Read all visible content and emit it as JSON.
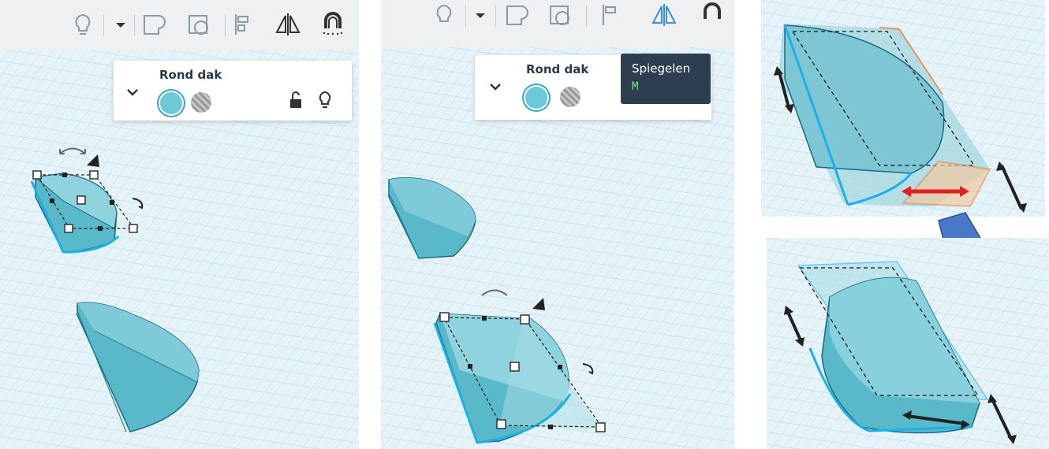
{
  "panel_left": {
    "properties": {
      "shape_name": "Rond dak",
      "solid_color": "#6cc9d8",
      "icons": [
        "chevron-down-icon",
        "unlock-icon",
        "lightbulb-icon"
      ]
    },
    "toolbar_icons": [
      "lightbulb-icon",
      "dropdown-caret-icon",
      "group-icon",
      "ungroup-icon",
      "align-icon",
      "mirror-icon",
      "magnet-icon"
    ]
  },
  "panel_middle": {
    "properties": {
      "shape_name": "Rond dak"
    },
    "tooltip": {
      "title": "Spiegelen",
      "shortcut": "M"
    },
    "active_tool": "mirror-icon"
  },
  "colors": {
    "shape": "#6cc9d8",
    "shape_dark": "#4aa5b6",
    "grid_bg": "#e8f4f8",
    "toolbar_bg": "#eef0f2",
    "mirror_active": "#3a8fd6",
    "tooltip_bg": "#2d3e50",
    "tooltip_shortcut": "#7ee07e",
    "arrow_red": "#e02020",
    "arrow_blue": "#4a78c8"
  }
}
